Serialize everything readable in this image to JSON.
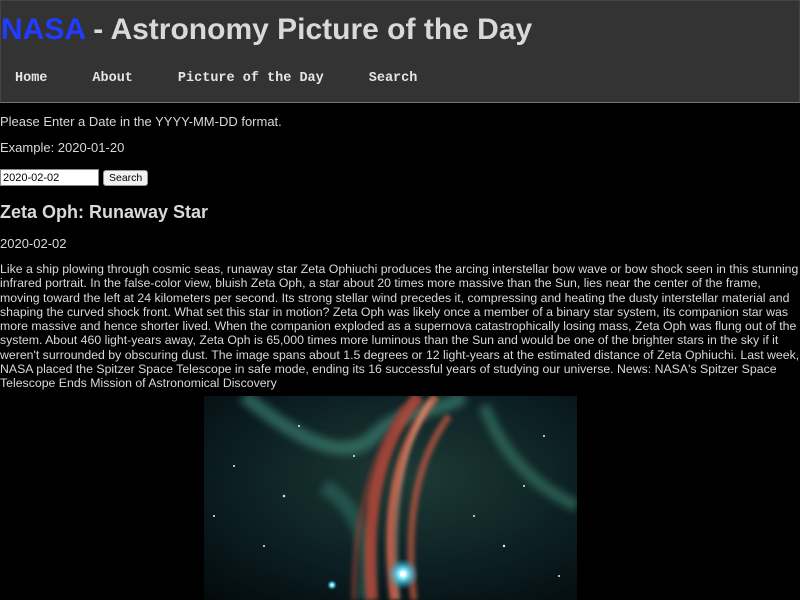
{
  "header": {
    "brand": "NASA",
    "title_rest": " - Astronomy Picture of the Day",
    "nav": [
      "Home",
      "About",
      "Picture of the Day",
      "Search"
    ]
  },
  "search": {
    "instructions": "Please Enter a Date in the YYYY-MM-DD format.",
    "example": "Example: 2020-01-20",
    "date_value": "2020-02-02",
    "button_label": "Search"
  },
  "apod": {
    "title": "Zeta Oph: Runaway Star",
    "date": "2020-02-02",
    "explanation": "Like a ship plowing through cosmic seas, runaway star Zeta Ophiuchi produces the arcing interstellar bow wave or bow shock seen in this stunning infrared portrait. In the false-color view, bluish Zeta Oph, a star about 20 times more massive than the Sun, lies near the center of the frame, moving toward the left at 24 kilometers per second. Its strong stellar wind precedes it, compressing and heating the dusty interstellar material and shaping the curved shock front. What set this star in motion? Zeta Oph was likely once a member of a binary star system, its companion star was more massive and hence shorter lived. When the companion exploded as a supernova catastrophically losing mass, Zeta Oph was flung out of the system. About 460 light-years away, Zeta Oph is 65,000 times more luminous than the Sun and would be one of the brighter stars in the sky if it weren't surrounded by obscuring dust. The image spans about 1.5 degrees or 12 light-years at the estimated distance of Zeta Ophiuchi. Last week, NASA placed the Spitzer Space Telescope in safe mode, ending its 16 successful years of studying our universe. News: NASA's Spitzer Space Telescope Ends Mission of Astronomical Discovery"
  },
  "colors": {
    "brand": "#1f3cff",
    "header_bg": "#333333",
    "page_bg": "#000000",
    "text": "#d9d9d9"
  }
}
